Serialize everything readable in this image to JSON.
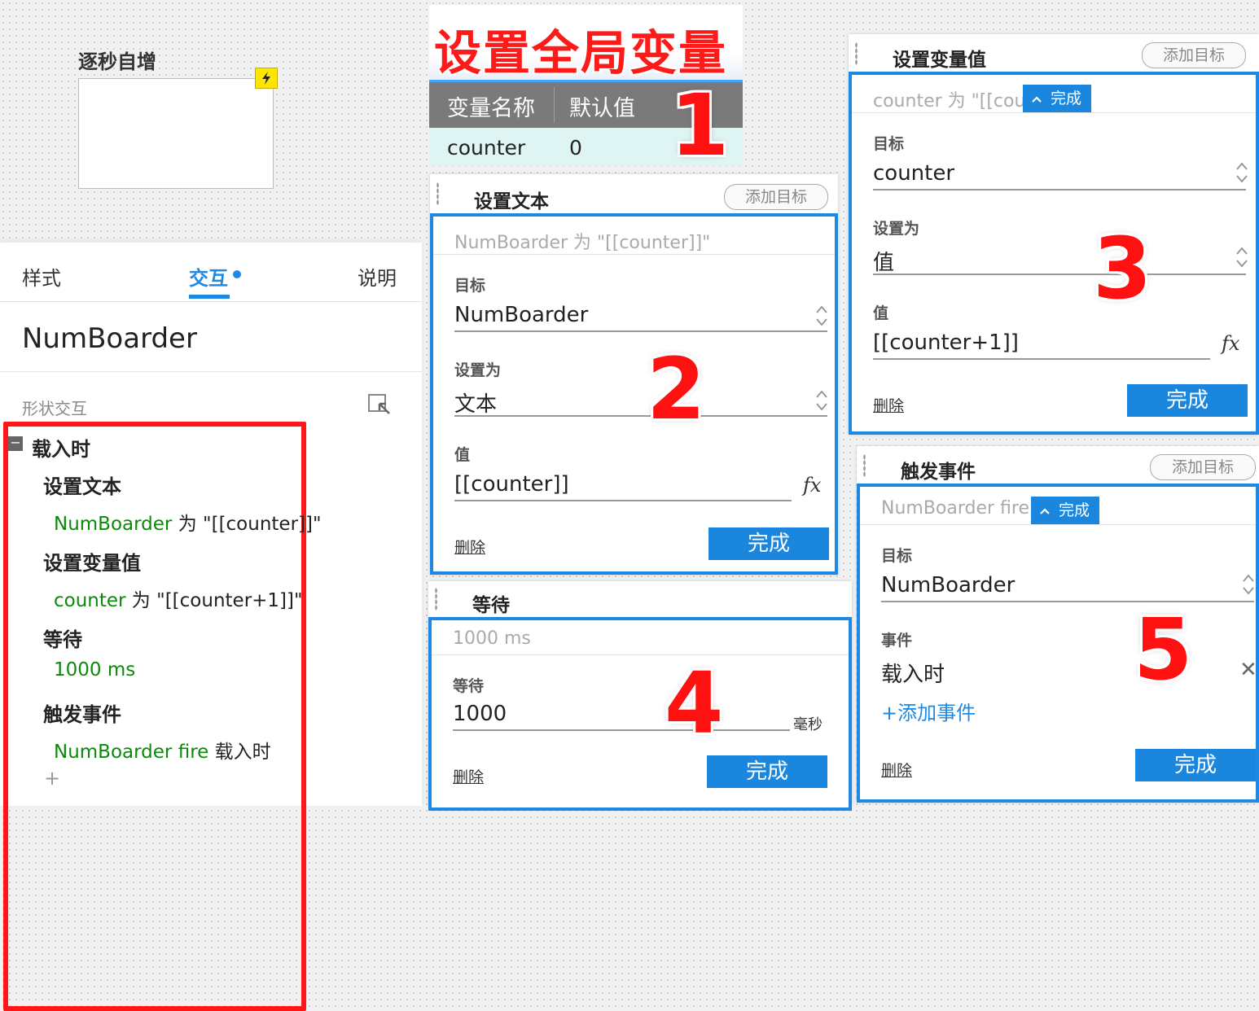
{
  "canvas": {
    "widget_label": "逐秒自增"
  },
  "left_panel": {
    "tabs": [
      {
        "label": "样式",
        "active": false
      },
      {
        "label": "交互",
        "active": true
      },
      {
        "label": "说明",
        "active": false
      }
    ],
    "widget_name": "NumBoarder",
    "section_label": "形状交互",
    "event": "载入时",
    "actions": [
      {
        "name": "设置文本",
        "target": "NumBoarder",
        "rest": " 为 \"[[counter]]\""
      },
      {
        "name": "设置变量值",
        "target": "counter",
        "rest": " 为 \"[[counter+1]]\""
      },
      {
        "name": "等待",
        "target": "1000 ms",
        "rest": ""
      },
      {
        "name": "触发事件",
        "target": "NumBoarder fire",
        "rest": " 载入时"
      }
    ],
    "add_symbol": "+"
  },
  "global_vars": {
    "title": "设置全局变量",
    "col_name": "变量名称",
    "col_default": "默认值",
    "rows": [
      {
        "name": "counter",
        "default": "0"
      }
    ],
    "step": "1"
  },
  "card_set_text": {
    "title": "设置文本",
    "add_target": "添加目标",
    "summary": "NumBoarder 为 \"[[counter]]\"",
    "target_label": "目标",
    "target_value": "NumBoarder",
    "set_as_label": "设置为",
    "set_as_value": "文本",
    "value_label": "值",
    "value": "[[counter]]",
    "fx": "fx",
    "delete": "删除",
    "done": "完成",
    "step": "2"
  },
  "card_set_var": {
    "title": "设置变量值",
    "add_target": "添加目标",
    "summary": "counter 为 \"[[cou",
    "mini_done": "完成",
    "target_label": "目标",
    "target_value": "counter",
    "set_as_label": "设置为",
    "set_as_value": "值",
    "value_label": "值",
    "value": "[[counter+1]]",
    "fx": "fx",
    "delete": "删除",
    "done": "完成",
    "step": "3"
  },
  "card_wait": {
    "title": "等待",
    "summary": "1000 ms",
    "wait_label": "等待",
    "wait_value": "1000",
    "unit": "毫秒",
    "delete": "删除",
    "done": "完成",
    "step": "4"
  },
  "card_fire_event": {
    "title": "触发事件",
    "add_target": "添加目标",
    "summary": "NumBoarder fire",
    "mini_done": "完成",
    "target_label": "目标",
    "target_value": "NumBoarder",
    "event_label": "事件",
    "event_value": "载入时",
    "add_event": "+添加事件",
    "delete": "删除",
    "done": "完成",
    "step": "5"
  },
  "colors": {
    "accent": "#1e88e5",
    "annotation_red": "#ff1717",
    "action_target_green": "#0b8a0b"
  },
  "icons": [
    "lightning-icon",
    "pick-widget-icon",
    "collapse-icon",
    "stepper-icon",
    "fx-icon",
    "close-icon",
    "chevron-up-icon",
    "drag-handle-icon"
  ]
}
